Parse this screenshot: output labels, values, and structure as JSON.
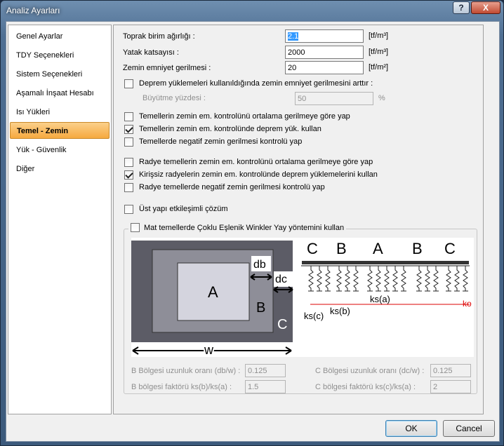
{
  "window": {
    "title": "Analiz Ayarları",
    "help": "?",
    "close": "X"
  },
  "sidebar": {
    "items": [
      {
        "label": "Genel Ayarlar"
      },
      {
        "label": "TDY Seçenekleri"
      },
      {
        "label": "Sistem Seçenekleri"
      },
      {
        "label": "Aşamalı İnşaat Hesabı"
      },
      {
        "label": "Isı Yükleri"
      },
      {
        "label": "Temel - Zemin"
      },
      {
        "label": "Yük - Güvenlik"
      },
      {
        "label": "Diğer"
      }
    ],
    "active_index": 5
  },
  "soil": {
    "unit_weight_label": "Toprak birim ağırlığı :",
    "unit_weight_value": "2.1",
    "unit_weight_unit": "[tf/m³]",
    "bed_coef_label": "Yatak katsayısı :",
    "bed_coef_value": "2000",
    "bed_coef_unit": "[tf/m³]",
    "allow_stress_label": "Zemin emniyet gerilmesi :",
    "allow_stress_value": "20",
    "allow_stress_unit": "[tf/m²]"
  },
  "quake": {
    "increase_label": "Deprem yüklemeleri kullanıldığında zemin emniyet gerilmesini arttır :",
    "increase_checked": false,
    "growth_label": "Büyütme yüzdesi :",
    "growth_value": "50",
    "growth_unit": "%"
  },
  "footing_opts": [
    {
      "label": "Temellerin zemin em. kontrolünü ortalama gerilmeye göre yap",
      "checked": false
    },
    {
      "label": "Temellerin zemin em. kontrolünde deprem yük. kullan",
      "checked": true
    },
    {
      "label": "Temellerde negatif zemin gerilmesi kontrolü yap",
      "checked": false
    }
  ],
  "raft_opts": [
    {
      "label": "Radye temellerin zemin em. kontrolünü ortalama gerilmeye göre yap",
      "checked": false
    },
    {
      "label": "Kirişsiz radyelerin zemin em. kontrolünde deprem yüklemelerini kullan",
      "checked": true
    },
    {
      "label": "Radye temellerde negatif zemin gerilmesi kontrolü yap",
      "checked": false
    }
  ],
  "super": {
    "label": "Üst yapı etkileşimli çözüm",
    "checked": false
  },
  "winkler": {
    "label": "Mat temellerde Çoklu Eşlenik Winkler Yay yöntemini kullan",
    "checked": false,
    "diagram": {
      "zone_a": "A",
      "zone_b": "B",
      "zone_c": "C",
      "db": "db",
      "dc": "dc",
      "w": "w",
      "ks_a": "ks(a)",
      "ks_b": "ks(b)",
      "ks_c": "ks(c)",
      "ko": "ko",
      "section_labels": [
        "C",
        "B",
        "A",
        "B",
        "C"
      ]
    },
    "b_ratio_label": "B Bölgesi uzunluk oranı (db/w) :",
    "b_ratio_value": "0.125",
    "c_ratio_label": "C Bölgesi uzunluk oranı (dc/w) :",
    "c_ratio_value": "0.125",
    "b_factor_label": "B bölgesi faktörü ks(b)/ks(a) :",
    "b_factor_value": "1.5",
    "c_factor_label": "C bölgesi faktörü ks(c)/ks(a) :",
    "c_factor_value": "2"
  },
  "buttons": {
    "ok": "OK",
    "cancel": "Cancel"
  }
}
